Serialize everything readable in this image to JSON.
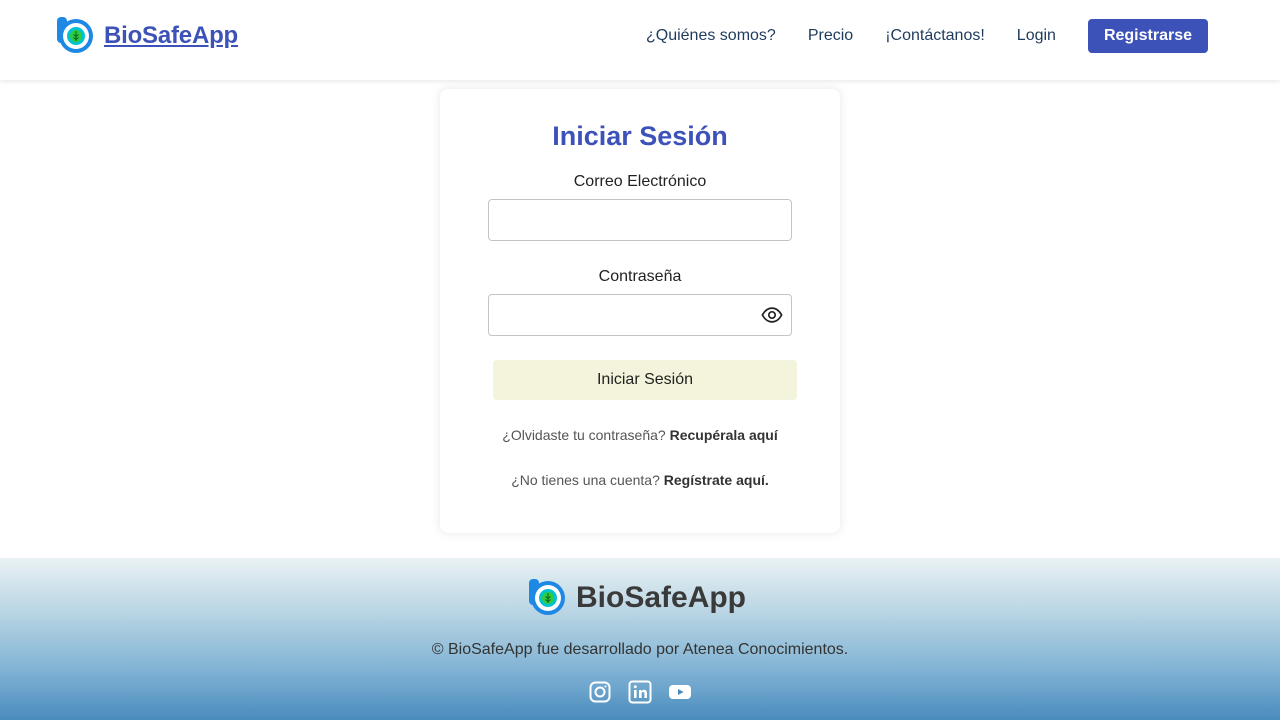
{
  "header": {
    "brand_name": "BioSafeApp",
    "nav": [
      "¿Quiénes somos?",
      "Precio",
      "¡Contáctanos!",
      "Login"
    ],
    "register_label": "Registrarse"
  },
  "login": {
    "title": "Iniciar Sesión",
    "email_label": "Correo Electrónico",
    "email_value": "",
    "password_label": "Contraseña",
    "password_value": "",
    "submit_label": "Iniciar Sesión",
    "forgot_text": "¿Olvidaste tu contraseña?",
    "forgot_link": "Recupérala aquí",
    "noaccount_text": "¿No tienes una cuenta?",
    "register_link": "Regístrate aquí."
  },
  "footer": {
    "brand_name": "BioSafeApp",
    "copyright": "© BioSafeApp fue desarrollado por Atenea Conocimientos.",
    "socials": [
      "instagram-icon",
      "linkedin-icon",
      "youtube-icon"
    ]
  },
  "colors": {
    "brand": "#3d52b8",
    "nav_text": "#1f3b5c",
    "login_button_bg": "#f4f4dc"
  }
}
